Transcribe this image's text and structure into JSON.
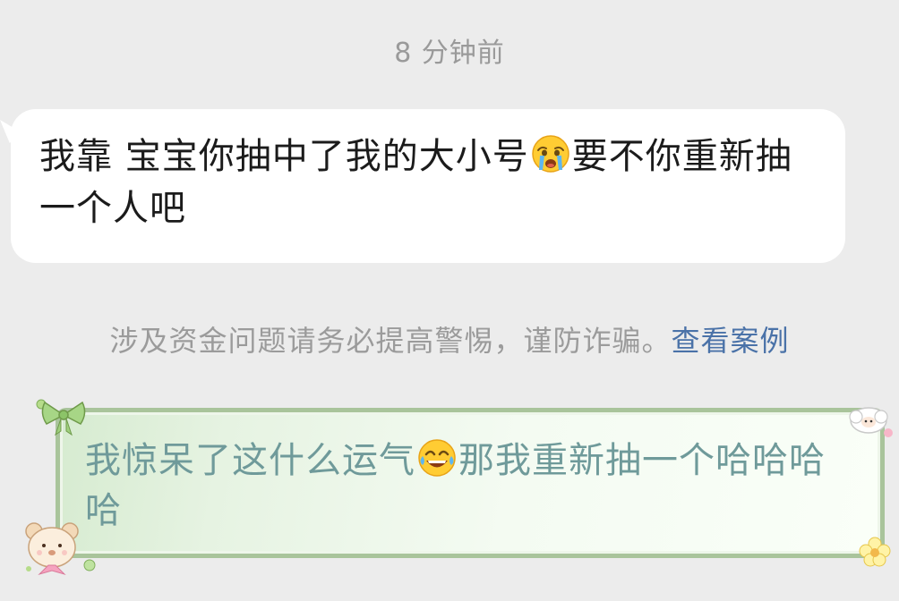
{
  "timestamp": "8 分钟前",
  "incoming_message": {
    "text_part1": "我靠 宝宝你抽中了我的大小号",
    "emoji": "loudly-crying-face",
    "text_part2": "要不你重新抽一个人吧"
  },
  "security_notice": {
    "text": "涉及资金问题请务必提高警惕，谨防诈骗。",
    "link_label": "查看案例"
  },
  "outgoing_message": {
    "text_part1": "我惊呆了这什么运气",
    "emoji": "face-with-tears-of-joy",
    "text_part2": "那我重新抽一个哈哈哈哈"
  },
  "colors": {
    "background": "#ececec",
    "incoming_bubble": "#ffffff",
    "outgoing_bubble_border": "#a9c49b",
    "outgoing_text": "#6f9a9a",
    "link": "#4a72a8",
    "muted_text": "#9a9a9a"
  }
}
